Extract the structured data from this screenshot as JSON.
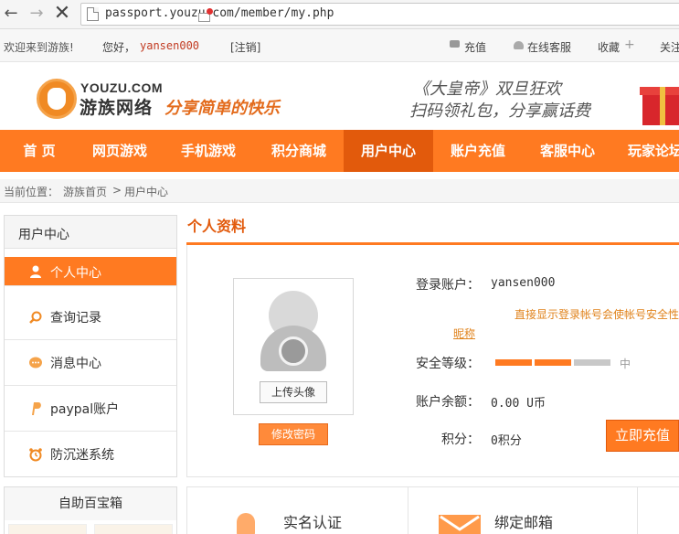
{
  "browser": {
    "url": "passport.youzu.com/member/my.php",
    "back_glyph": "←",
    "forward_glyph": "→",
    "stop_glyph": "✕"
  },
  "topbar": {
    "welcome": "欢迎来到游族!",
    "hello": "您好，",
    "username": "yansen000",
    "logout": "[注销]",
    "recharge": "充值",
    "service": "在线客服",
    "favorite": "收藏",
    "favorite_plus": "+",
    "about": "关注"
  },
  "header": {
    "logo_en": "YOUZU.COM",
    "logo_cn": "游族网络",
    "slogan": "分享简单的快乐",
    "promo_line1": "《大皇帝》双旦狂欢",
    "promo_line2": "扫码领礼包，分享赢话费"
  },
  "nav": {
    "items": [
      "首 页",
      "网页游戏",
      "手机游戏",
      "积分商城",
      "用户中心",
      "账户充值",
      "客服中心",
      "玩家论坛"
    ],
    "active_index": 4
  },
  "breadcrumb": {
    "prefix": "当前位置：",
    "home": "游族首页",
    "separator": ">",
    "current": "用户中心"
  },
  "sidebar": {
    "title": "用户中心",
    "items": [
      {
        "label": "个人中心",
        "icon": "person-icon"
      },
      {
        "label": "查询记录",
        "icon": "search-icon"
      },
      {
        "label": "消息中心",
        "icon": "message-icon"
      },
      {
        "label": "paypal账户",
        "icon": "paypal-icon"
      },
      {
        "label": "防沉迷系统",
        "icon": "alarm-clock-icon"
      }
    ],
    "active_index": 0,
    "help_title": "自助百宝箱"
  },
  "profile": {
    "title": "个人资料",
    "upload_avatar": "上传头像",
    "change_password": "修改密码",
    "account_label": "登录账户：",
    "account_value": "yansen000",
    "tip": "直接显示登录帐号会使帐号安全性",
    "nickname_link": "昵称",
    "security_label": "安全等级：",
    "security_level_text": "中",
    "security_level_fraction": 0.67,
    "balance_label": "账户余额：",
    "balance_value": "0.00 U币",
    "points_label": "积分：",
    "points_value": "0积分",
    "recharge_button": "立即充值"
  },
  "cards": {
    "real_name": "实名认证",
    "bind_email": "绑定邮箱"
  },
  "colors": {
    "accent": "#ff7a21",
    "accent_dark": "#e25a0c",
    "link_orange": "#e0831c",
    "username_red": "#c23b22"
  }
}
